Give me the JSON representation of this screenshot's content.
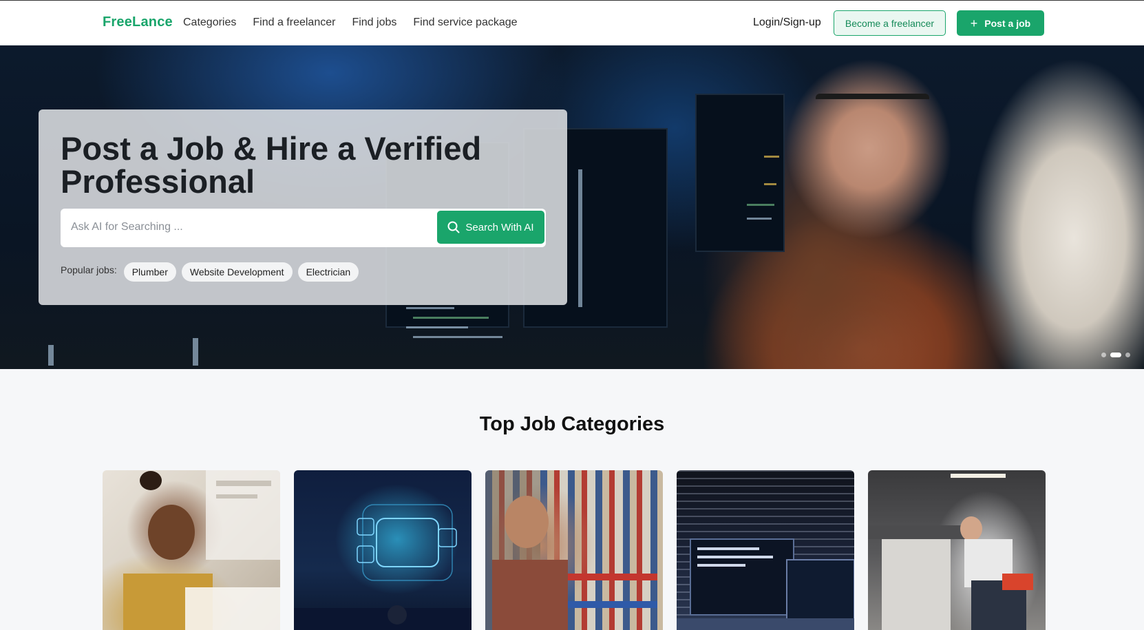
{
  "navbar": {
    "logo": "FreeLance",
    "links": [
      "Categories",
      "Find a freelancer",
      "Find jobs",
      "Find service package"
    ],
    "login": "Login/Sign-up",
    "become_label": "Become a freelancer",
    "post_label": "Post a job"
  },
  "hero": {
    "title": "Post a Job & Hire a Verified Professional",
    "search": {
      "placeholder": "Ask AI for Searching ...",
      "button_label": "Search With AI"
    },
    "popular_label": "Popular jobs:",
    "popular_jobs": [
      "Plumber",
      "Website Development",
      "Electrician"
    ],
    "carousel": {
      "total": 3,
      "active_index": 1
    }
  },
  "categories_section": {
    "title": "Top Job Categories"
  },
  "colors": {
    "brand": "#1aa56b",
    "text": "#1b1f24"
  },
  "icons": {
    "post_button": "plus-icon",
    "search_button": "search-icon"
  }
}
